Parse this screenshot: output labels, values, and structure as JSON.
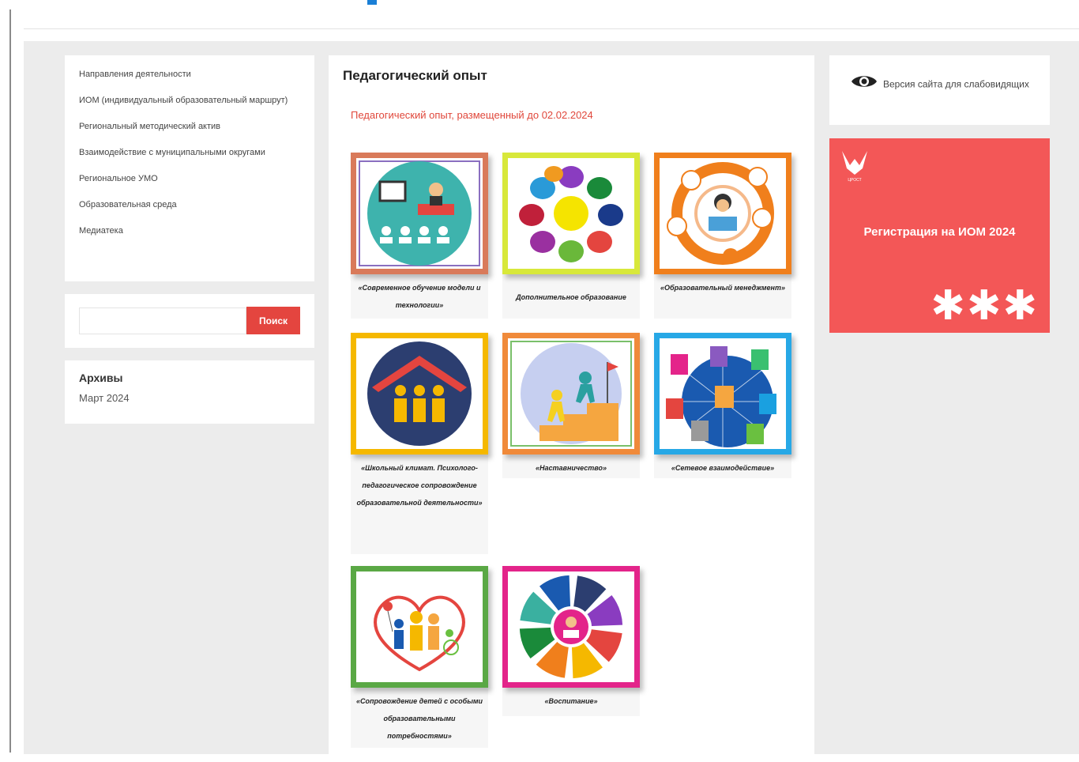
{
  "menu": {
    "items": [
      "Направления деятельности",
      "ИОМ (индивидуальный образовательный маршрут)",
      "Региональный методический актив",
      "Взаимодействие с муниципальными округами",
      "Региональное УМО",
      "Образовательная среда",
      "Медиатека"
    ]
  },
  "search": {
    "placeholder": "",
    "button_label": "Поиск"
  },
  "archives": {
    "title": "Архивы",
    "items": [
      "Март 2024"
    ]
  },
  "main": {
    "title": "Педагогический опыт",
    "subtitle": "Педагогический опыт, размещенный до 02.02.2024",
    "tiles": [
      {
        "caption": "«Современное обучение модели и технологии»",
        "border_color": "#d97a5a",
        "icon": "teacher-presentation-icon"
      },
      {
        "caption": "Дополнительное образование",
        "border_color": "#d8e83a",
        "icon": "petal-flower-icon"
      },
      {
        "caption": "«Образовательный менеджмент»",
        "border_color": "#f07f1c",
        "icon": "manager-cycle-icon"
      },
      {
        "caption": "«Школьный климат. Психолого-педагогическое сопровождение образовательной деятельности»",
        "border_color": "#f5b800",
        "icon": "school-house-icon"
      },
      {
        "caption": "«Наставничество»",
        "border_color": "#f08a3a",
        "icon": "mentoring-stairs-icon"
      },
      {
        "caption": "«Сетевое взаимодействие»",
        "border_color": "#27a8e6",
        "icon": "network-globe-icon"
      },
      {
        "caption": "«Сопровождение детей с особыми образовательными потребностями»",
        "border_color": "#5aa845",
        "icon": "family-heart-icon"
      },
      {
        "caption": "«Воспитание»",
        "border_color": "#e3248a",
        "icon": "upbringing-wheel-icon"
      }
    ]
  },
  "accessibility": {
    "label": "Версия сайта для слабовидящих"
  },
  "banner": {
    "text": "Регистрация на ИОМ 2024",
    "stars": "✱✱✱",
    "logo_caption": "ЦРОСТ",
    "color": "#f35757"
  }
}
